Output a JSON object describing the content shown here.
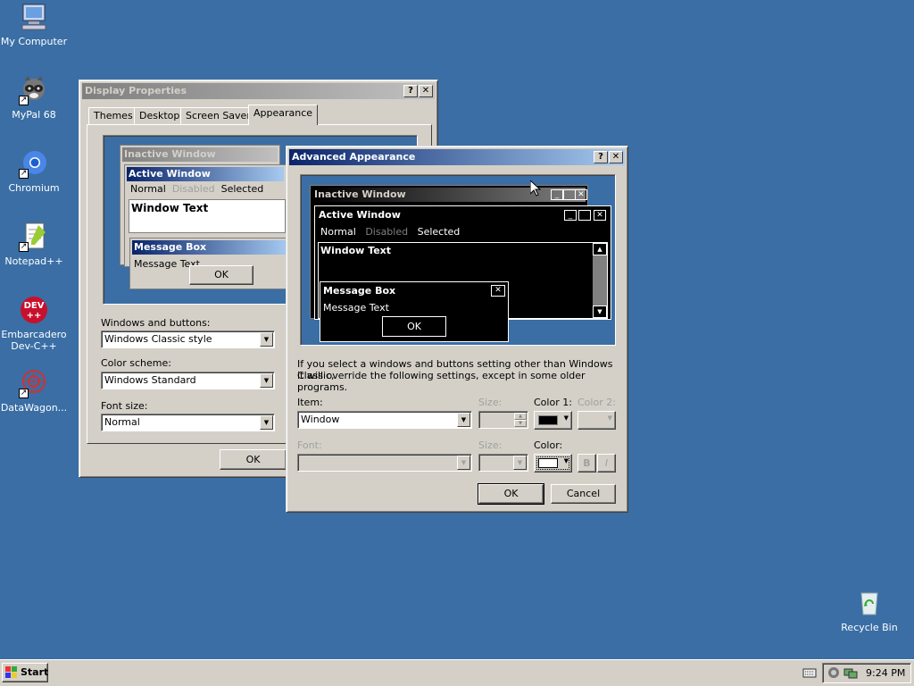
{
  "desktop": {
    "icons": [
      {
        "label": "My Computer"
      },
      {
        "label": "MyPal 68"
      },
      {
        "label": "Chromium"
      },
      {
        "label": "Notepad++"
      },
      {
        "label": "Embarcadero Dev-C++"
      },
      {
        "label": "DataWagon..."
      },
      {
        "label": "Recycle Bin"
      }
    ],
    "background_color": "#3a6ea5"
  },
  "display_properties": {
    "title": "Display Properties",
    "help_btn": "?",
    "close_btn": "✕",
    "tabs": [
      "Themes",
      "Desktop",
      "Screen Saver",
      "Appearance"
    ],
    "selected_tab": "Appearance",
    "preview": {
      "inactive_title": "Inactive Window",
      "active_title": "Active Window",
      "menu_normal": "Normal",
      "menu_disabled": "Disabled",
      "menu_selected": "Selected",
      "window_text": "Window Text",
      "msgbox_title": "Message Box",
      "msgbox_text": "Message Text",
      "ok": "OK"
    },
    "windows_buttons_label": "Windows and buttons:",
    "windows_buttons_value": "Windows Classic style",
    "color_scheme_label": "Color scheme:",
    "color_scheme_value": "Windows Standard",
    "font_size_label": "Font size:",
    "font_size_value": "Normal",
    "ok": "OK"
  },
  "advanced": {
    "title": "Advanced Appearance",
    "help_btn": "?",
    "close_btn": "✕",
    "preview": {
      "inactive_title": "Inactive Window",
      "active_title": "Active Window",
      "menu_normal": "Normal",
      "menu_disabled": "Disabled",
      "menu_selected": "Selected",
      "window_text": "Window Text",
      "msgbox_title": "Message Box",
      "msgbox_text": "Message Text",
      "ok": "OK"
    },
    "info_text_1": "If you select a windows and buttons setting other than Windows Classic,",
    "info_text_2": "it will override the following settings, except in some older programs.",
    "item_label": "Item:",
    "item_value": "Window",
    "size_label": "Size:",
    "color1_label": "Color 1:",
    "color2_label": "Color 2:",
    "font_label": "Font:",
    "size2_label": "Size:",
    "color_label": "Color:",
    "bold": "B",
    "italic": "I",
    "ok": "OK",
    "cancel": "Cancel",
    "color1_value": "#000000",
    "color_value": "#ffffff"
  },
  "taskbar": {
    "start": "Start",
    "clock": "9:24 PM"
  }
}
